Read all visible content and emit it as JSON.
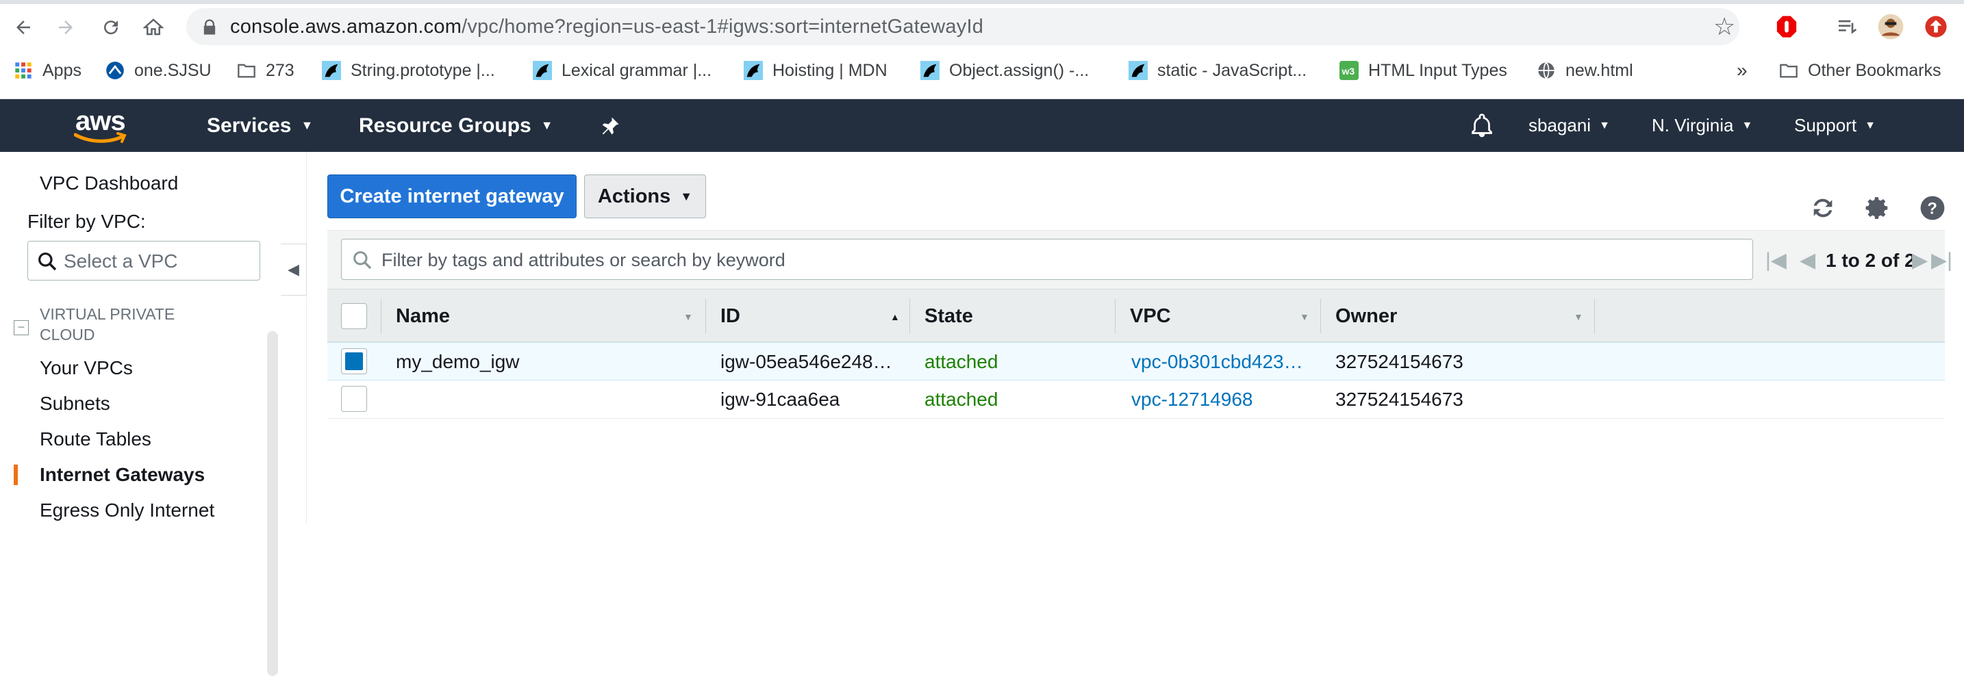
{
  "browser": {
    "url_host": "console.aws.amazon.com",
    "url_path": "/vpc/home?region=us-east-1#igws:sort=internetGatewayId",
    "bookmarks": [
      {
        "label": "Apps",
        "icon": "apps-grid-icon"
      },
      {
        "label": "one.SJSU",
        "icon": "sjsu-icon"
      },
      {
        "label": "273",
        "icon": "folder-icon"
      },
      {
        "label": "String.prototype |...",
        "icon": "mdn-icon"
      },
      {
        "label": "Lexical grammar |...",
        "icon": "mdn-icon"
      },
      {
        "label": "Hoisting | MDN",
        "icon": "mdn-icon"
      },
      {
        "label": "Object.assign() -...",
        "icon": "mdn-icon"
      },
      {
        "label": "static - JavaScript...",
        "icon": "mdn-icon"
      },
      {
        "label": "HTML Input Types",
        "icon": "w3-icon"
      },
      {
        "label": "new.html",
        "icon": "globe-icon"
      }
    ],
    "overflow": "»",
    "other_bookmarks": "Other Bookmarks"
  },
  "aws_header": {
    "logo": "aws",
    "services": "Services",
    "resource_groups": "Resource Groups",
    "user": "sbagani",
    "region": "N. Virginia",
    "support": "Support"
  },
  "sidebar": {
    "dashboard": "VPC Dashboard",
    "filter_label": "Filter by VPC:",
    "select_placeholder": "Select a VPC",
    "section_title_1": "VIRTUAL PRIVATE",
    "section_title_2": "CLOUD",
    "items": [
      "Your VPCs",
      "Subnets",
      "Route Tables",
      "Internet Gateways",
      "Egress Only Internet"
    ],
    "active_index": 3
  },
  "toolbar": {
    "create_label": "Create internet gateway",
    "actions_label": "Actions"
  },
  "table": {
    "search_placeholder": "Filter by tags and attributes or search by keyword",
    "pager_text": "1 to 2 of 2",
    "columns": [
      "Name",
      "ID",
      "State",
      "VPC",
      "Owner"
    ],
    "sorted_column": "ID",
    "rows": [
      {
        "selected": true,
        "name": "my_demo_igw",
        "id": "igw-05ea546e248…",
        "state": "attached",
        "vpc": "vpc-0b301cbd423…",
        "owner": "327524154673"
      },
      {
        "selected": false,
        "name": "",
        "id": "igw-91caa6ea",
        "state": "attached",
        "vpc": "vpc-12714968",
        "owner": "327524154673"
      }
    ]
  },
  "colors": {
    "aws_header": "#232f3e",
    "primary_button": "#2275d7",
    "state_green": "#1d8102",
    "link_blue": "#0073bb",
    "active_accent": "#ec7211"
  }
}
